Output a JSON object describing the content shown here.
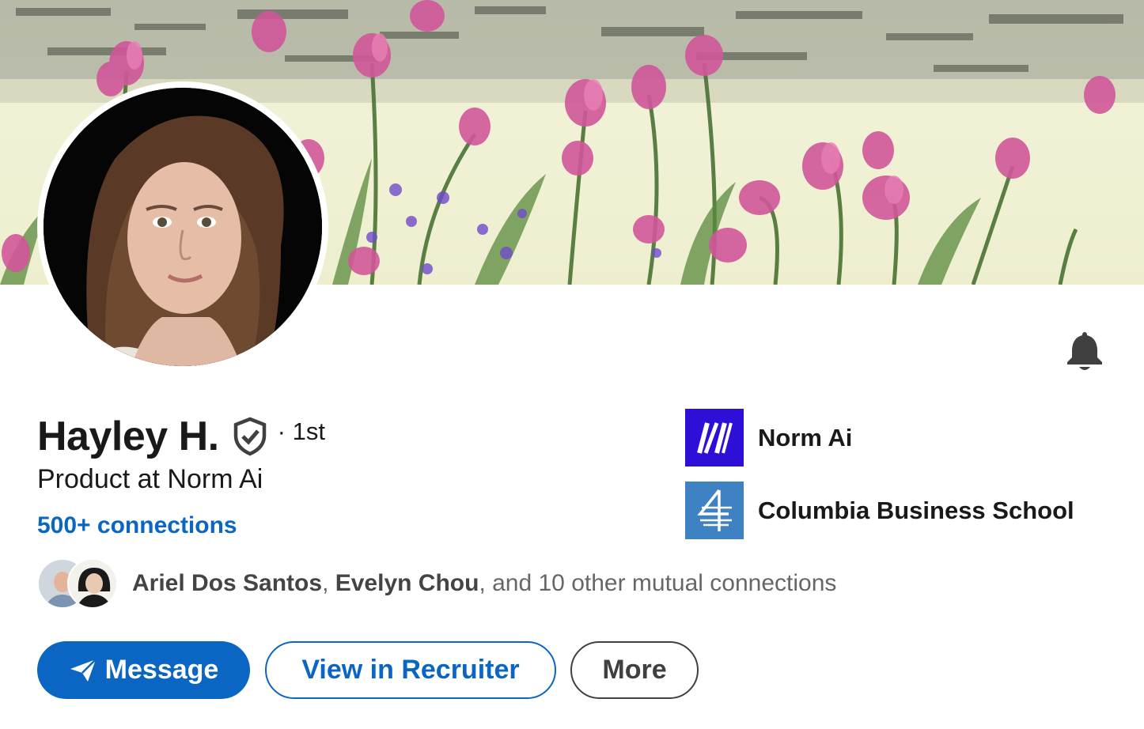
{
  "profile": {
    "name": "Hayley H.",
    "degree": "· 1st",
    "headline": "Product at Norm Ai",
    "connections": "500+ connections"
  },
  "mutuals": {
    "name1": "Ariel Dos Santos",
    "sep": ", ",
    "name2": "Evelyn Chou",
    "rest": ", and 10 other mutual connections"
  },
  "companies": [
    {
      "name": "Norm Ai",
      "icon": "norm-ai-logo"
    },
    {
      "name": "Columbia Business School",
      "icon": "columbia-logo"
    }
  ],
  "actions": {
    "message": "Message",
    "recruiter": "View in Recruiter",
    "more": "More"
  },
  "icons": {
    "bell": "bell-icon",
    "verified": "verified-shield-icon",
    "send": "paper-plane-icon"
  },
  "colors": {
    "accent": "#0a66c2",
    "norm_logo_bg": "#2d0fd8",
    "cbs_logo_bg": "#3e82c4"
  }
}
